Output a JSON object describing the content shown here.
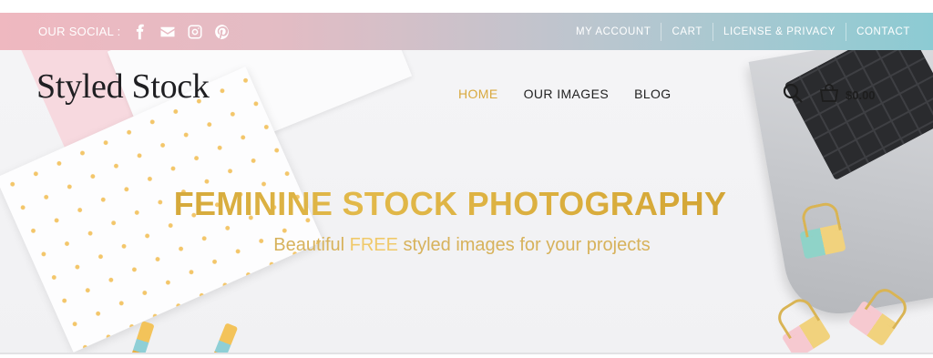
{
  "topbar": {
    "social_label": "OUR SOCIAL :",
    "social_icons": [
      "facebook-icon",
      "envelope-icon",
      "instagram-icon",
      "pinterest-icon"
    ],
    "nav": [
      "MY ACCOUNT",
      "CART",
      "LICENSE & PRIVACY",
      "CONTACT"
    ],
    "gradient_colors": [
      "#efb8c0",
      "#8ccbd3"
    ]
  },
  "header": {
    "logo": "Styled Stock",
    "nav": [
      {
        "label": "HOME",
        "active": true
      },
      {
        "label": "OUR IMAGES",
        "active": false
      },
      {
        "label": "BLOG",
        "active": false
      }
    ],
    "icons": [
      "search-icon",
      "cart-icon"
    ],
    "cart_total": "$0.00"
  },
  "hero": {
    "headline": "FEMININE STOCK PHOTOGRAPHY",
    "tagline_before": "Beautiful ",
    "tagline_highlight": "FREE",
    "tagline_after": " styled images for your projects"
  },
  "colors": {
    "accent_gold": "#d9a93f",
    "text_dark": "#222222"
  }
}
